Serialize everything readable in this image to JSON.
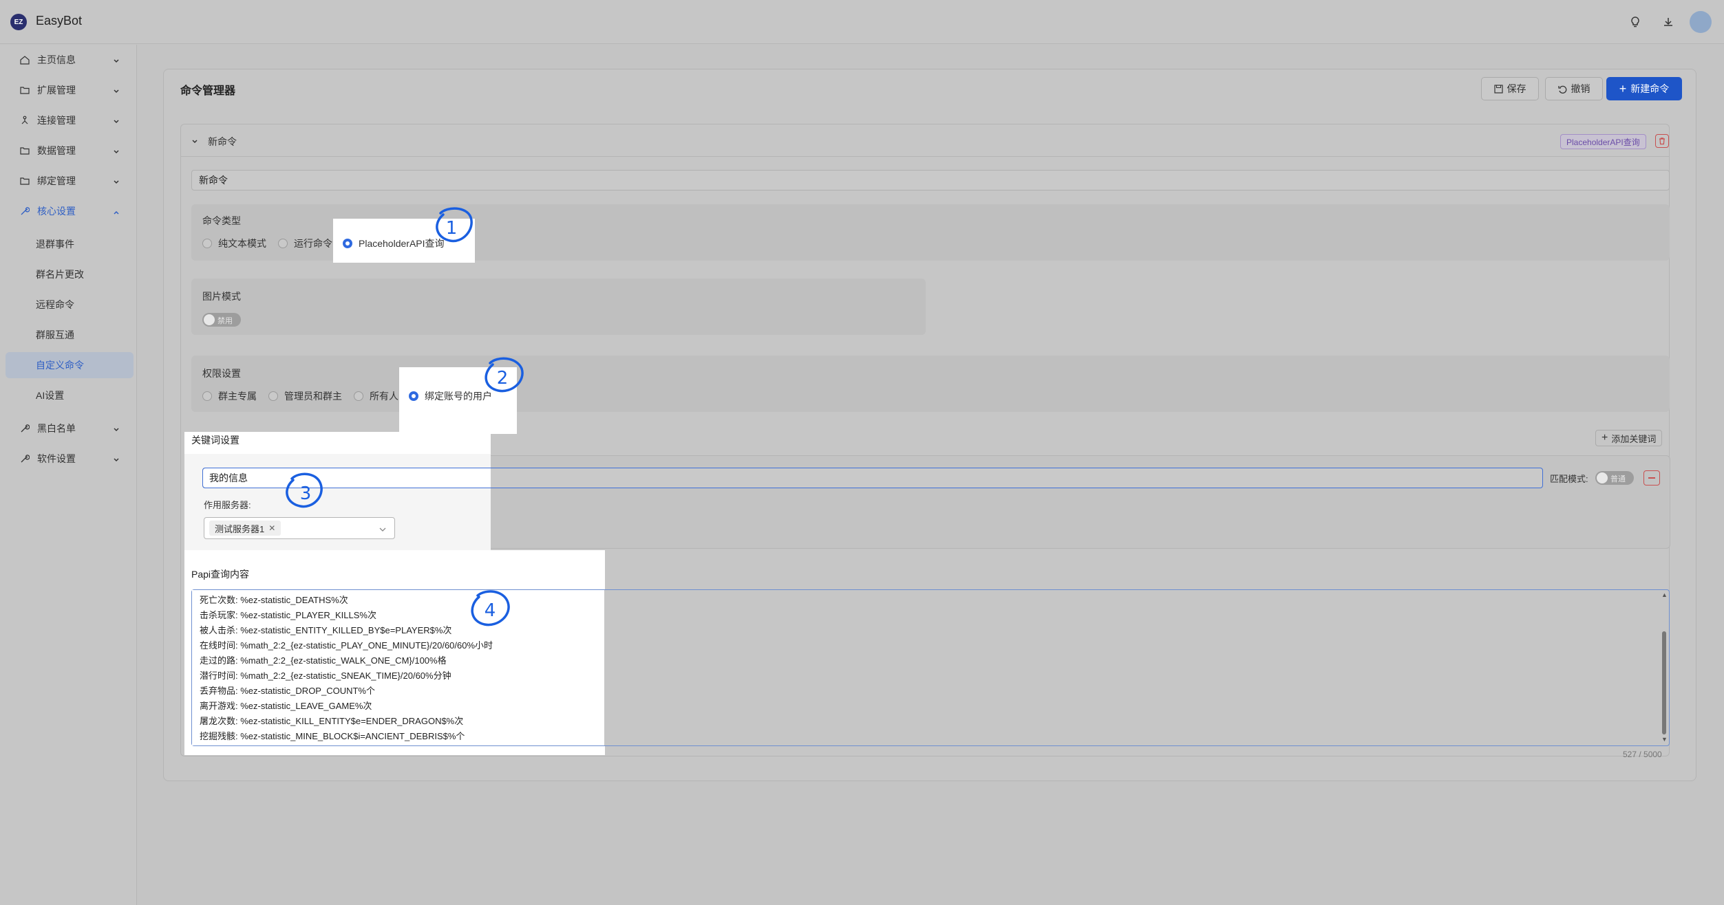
{
  "app": {
    "logo_text": "EZ",
    "title": "EasyBot"
  },
  "topbar": {
    "icons": [
      "bulb-icon",
      "download-icon",
      "avatar"
    ]
  },
  "sidebar": {
    "items": [
      {
        "label": "主页信息",
        "icon": "home-icon"
      },
      {
        "label": "扩展管理",
        "icon": "folder-icon"
      },
      {
        "label": "连接管理",
        "icon": "connection-icon"
      },
      {
        "label": "数据管理",
        "icon": "folder-icon"
      },
      {
        "label": "绑定管理",
        "icon": "folder-icon"
      },
      {
        "label": "核心设置",
        "icon": "wrench-icon"
      }
    ],
    "sub_items": [
      "退群事件",
      "群名片更改",
      "远程命令",
      "群服互通",
      "自定义命令",
      "AI设置"
    ],
    "bottom_items": [
      {
        "label": "黑白名单",
        "icon": "wrench-icon"
      },
      {
        "label": "软件设置",
        "icon": "wrench-icon"
      }
    ]
  },
  "main": {
    "title": "命令管理器",
    "buttons": {
      "save": "保存",
      "undo": "撤销",
      "new_command": "新建命令"
    },
    "command": {
      "header_name": "新命令",
      "tag": "PlaceholderAPI查询",
      "name_value": "新命令",
      "type_section": {
        "label": "命令类型",
        "options": [
          "纯文本模式",
          "运行命令",
          "PlaceholderAPI查询"
        ],
        "selected": "PlaceholderAPI查询"
      },
      "image_section": {
        "label": "图片模式",
        "toggle_label": "禁用",
        "enabled": false
      },
      "permission_section": {
        "label": "权限设置",
        "options": [
          "群主专属",
          "管理员和群主",
          "所有人",
          "绑定账号的用户"
        ],
        "selected": "绑定账号的用户"
      },
      "keyword_section": {
        "label": "关键词设置",
        "add_button": "添加关键词",
        "keyword_value": "我的信息",
        "match_label": "匹配模式:",
        "match_toggle": "普通",
        "server_label": "作用服务器:",
        "server_chip": "测试服务器1"
      },
      "papi_section": {
        "label": "Papi查询内容",
        "lines": [
          "死亡次数: %ez-statistic_DEATHS%次",
          "击杀玩家: %ez-statistic_PLAYER_KILLS%次",
          "被人击杀: %ez-statistic_ENTITY_KILLED_BY$e=PLAYER$%次",
          "在线时间: %math_2:2_{ez-statistic_PLAY_ONE_MINUTE}/20/60/60%小时",
          "走过的路: %math_2:2_{ez-statistic_WALK_ONE_CM}/100%格",
          "潜行时间: %math_2:2_{ez-statistic_SNEAK_TIME}/20/60%分钟",
          "丢弃物品: %ez-statistic_DROP_COUNT%个",
          "离开游戏: %ez-statistic_LEAVE_GAME%次",
          "屠龙次数: %ez-statistic_KILL_ENTITY$e=ENDER_DRAGON$%次",
          "挖掘残骸: %ez-statistic_MINE_BLOCK$i=ANCIENT_DEBRIS$%个"
        ],
        "counter": "527 / 5000"
      }
    }
  },
  "annotations": [
    "1",
    "2",
    "3",
    "4"
  ],
  "colors": {
    "accent": "#1e55c8",
    "annotation": "#1a5fe0",
    "tag": "#6b4da8",
    "danger": "#c85050"
  }
}
